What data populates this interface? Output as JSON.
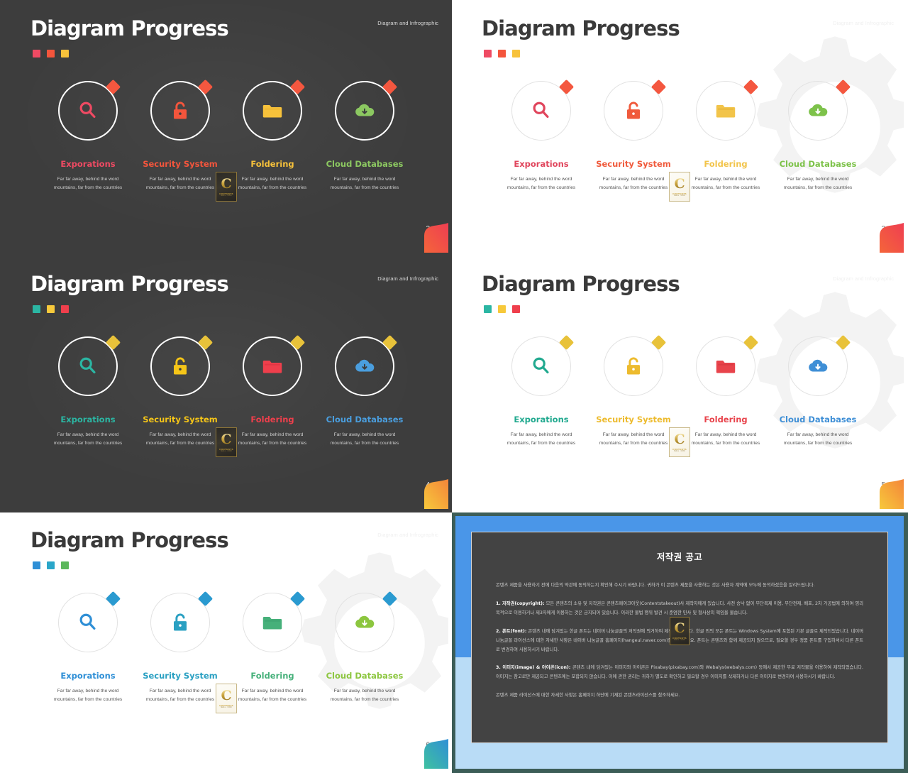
{
  "theme": {
    "page_background": "#3c5d57",
    "dark_slide_bg": "#3d3d3d",
    "light_slide_bg": "#ffffff"
  },
  "common": {
    "title": "Diagram Progress",
    "eyebrow": "Diagram and Infrographic",
    "stamp": {
      "letter": "C",
      "word": "CONTENTS",
      "sub": "MALL . COM"
    },
    "steps_labels": [
      "Exporations",
      "Security System",
      "Foldering",
      "Cloud Databases"
    ],
    "step_description": "Far far away, behind the word mountains, far from the countries",
    "icons": [
      "search-icon",
      "unlock-icon",
      "folder-icon",
      "cloud-download-icon"
    ]
  },
  "slides": [
    {
      "id": "slide-2",
      "theme": "dark",
      "page_number": "2",
      "title": "Diagram Progress",
      "eyebrow": "Diagram and Infrographic",
      "dots": [
        "#ef4a63",
        "#f4553c",
        "#f7c23b"
      ],
      "diamond_color": "#f4573f",
      "corner_from": "#f4653a",
      "corner_to": "#ef3e52",
      "steps": [
        {
          "label": "Exporations",
          "color": "#ef4a63",
          "icon_color": "#ef4a63",
          "icon": "search-icon",
          "desc": "Far far away, behind the word mountains, far from the countries"
        },
        {
          "label": "Security System",
          "color": "#f4553c",
          "icon_color": "#f4553c",
          "icon": "unlock-icon",
          "desc": "Far far away, behind the word mountains, far from the countries"
        },
        {
          "label": "Foldering",
          "color": "#f7c23b",
          "icon_color": "#f7c23b",
          "icon": "folder-icon",
          "desc": "Far far away, behind the word mountains, far from the countries"
        },
        {
          "label": "Cloud Databases",
          "color": "#8cc861",
          "icon_color": "#8cc861",
          "icon": "cloud-download-icon",
          "desc": "Far far away, behind the word mountains, far from the countries"
        }
      ]
    },
    {
      "id": "slide-3",
      "theme": "light",
      "page_number": "3",
      "title": "Diagram Progress",
      "eyebrow": "Diagram and Infrographic",
      "dots": [
        "#ef4a63",
        "#f4553c",
        "#f7c23b"
      ],
      "diamond_color": "#f4573f",
      "corner_from": "#f4653a",
      "corner_to": "#ef3e52",
      "steps": [
        {
          "label": "Exporations",
          "color": "#e0455c",
          "icon_color": "#e0455c",
          "icon": "search-icon",
          "desc": "Far far away, behind the word mountains, far from the countries"
        },
        {
          "label": "Security System",
          "color": "#f05a3c",
          "icon_color": "#f05a3c",
          "icon": "unlock-icon",
          "desc": "Far far away, behind the word mountains, far from the countries"
        },
        {
          "label": "Foldering",
          "color": "#f2c44a",
          "icon_color": "#f2c44a",
          "icon": "folder-icon",
          "desc": "Far far away, behind the word mountains, far from the countries"
        },
        {
          "label": "Cloud Databases",
          "color": "#7dc24a",
          "icon_color": "#7dc24a",
          "icon": "cloud-download-icon",
          "desc": "Far far away, behind the word mountains, far from the countries"
        }
      ]
    },
    {
      "id": "slide-4",
      "theme": "dark",
      "page_number": "4",
      "title": "Diagram Progress",
      "eyebrow": "Diagram and Infrographic",
      "dots": [
        "#2bb6a3",
        "#f7c93b",
        "#ef3f4c"
      ],
      "diamond_color": "#e8c23a",
      "corner_from": "#f7c93b",
      "corner_to": "#f4853a",
      "steps": [
        {
          "label": "Exporations",
          "color": "#2bb6a3",
          "icon_color": "#2bb6a3",
          "icon": "search-icon",
          "desc": "Far far away, behind the word mountains, far from the countries"
        },
        {
          "label": "Security System",
          "color": "#f5c518",
          "icon_color": "#f5c518",
          "icon": "unlock-icon",
          "desc": "Far far away, behind the word mountains, far from the countries"
        },
        {
          "label": "Foldering",
          "color": "#ef3f4c",
          "icon_color": "#ef3f4c",
          "icon": "folder-icon",
          "desc": "Far far away, behind the word mountains, far from the countries"
        },
        {
          "label": "Cloud Databases",
          "color": "#4a9ede",
          "icon_color": "#4a9ede",
          "icon": "cloud-download-icon",
          "desc": "Far far away, behind the word mountains, far from the countries"
        }
      ]
    },
    {
      "id": "slide-5",
      "theme": "light",
      "page_number": "5",
      "title": "Diagram Progress",
      "eyebrow": "Diagram and Infrographic",
      "dots": [
        "#2bb6a3",
        "#f7c93b",
        "#ef3f4c"
      ],
      "diamond_color": "#e8c23a",
      "corner_from": "#f7c93b",
      "corner_to": "#f4853a",
      "steps": [
        {
          "label": "Exporations",
          "color": "#21a98f",
          "icon_color": "#21a98f",
          "icon": "search-icon",
          "desc": "Far far away, behind the word mountains, far from the countries"
        },
        {
          "label": "Security System",
          "color": "#edbb2e",
          "icon_color": "#edbb2e",
          "icon": "unlock-icon",
          "desc": "Far far away, behind the word mountains, far from the countries"
        },
        {
          "label": "Foldering",
          "color": "#e8434b",
          "icon_color": "#e8434b",
          "icon": "folder-icon",
          "desc": "Far far away, behind the word mountains, far from the countries"
        },
        {
          "label": "Cloud Databases",
          "color": "#3f8fd6",
          "icon_color": "#3f8fd6",
          "icon": "cloud-download-icon",
          "desc": "Far far away, behind the word mountains, far from the countries"
        }
      ]
    },
    {
      "id": "slide-6",
      "theme": "light",
      "page_number": "6",
      "title": "Diagram Progress",
      "eyebrow": "Diagram and Infrographic",
      "dots": [
        "#2f8fd6",
        "#2aa6c9",
        "#5cb85c"
      ],
      "diamond_color": "#2a9ad0",
      "corner_from": "#2fa3d8",
      "corner_to": "#3fc1a0",
      "steps": [
        {
          "label": "Exporations",
          "color": "#2f8fd6",
          "icon_color": "#2f8fd6",
          "icon": "search-icon",
          "desc": "Far far away, behind the word mountains, far from the countries"
        },
        {
          "label": "Security System",
          "color": "#2aa0c2",
          "icon_color": "#2aa0c2",
          "icon": "unlock-icon",
          "desc": "Far far away, behind the word mountains, far from the countries"
        },
        {
          "label": "Foldering",
          "color": "#46b07a",
          "icon_color": "#46b07a",
          "icon": "folder-icon",
          "desc": "Far far away, behind the word mountains, far from the countries"
        },
        {
          "label": "Cloud Databases",
          "color": "#8cc63f",
          "icon_color": "#8cc63f",
          "icon": "cloud-download-icon",
          "desc": "Far far away, behind the word mountains, far from the countries"
        }
      ]
    }
  ],
  "copyright_slide": {
    "id": "slide-copyright",
    "frame_color": "#4a96e8",
    "lower_color": "#b9dcf6",
    "card_color": "#434343",
    "title": "저작권 공고",
    "paragraphs": [
      {
        "lead": "",
        "text": "콘텐츠 제품을 사용하기 전에 다음의 약관에 동의하는지 확인해 주시기 바랍니다. 귀하가 이 콘텐츠 제품을 사용하는 것은 사용자 계약에 모두에 동의하셨음을 알려드립니다."
      },
      {
        "lead": "1. 저작권(copyright):",
        "text": " 모든 콘텐츠의 소유 및 저작권은 콘텐츠메이크아웃(Contentstakeout)사 제작자에게 있습니다. 사전 승낙 없이 무단복제 이용, 무단전재, 배포, 2차 가공법에 의하여 영리 목적으로 이용하거나 제3자에게 이용하는 것은 금지되어 있습니다. 이러한 불법 행위 발견 시 준엄한 민사 및 형사상의 책임을 물습니다."
      },
      {
        "lead": "2. 폰트(font):",
        "text": " 콘텐츠 내에 담겨있는 한글 폰트는 네이버 나눔글꼴의 저작권에 의거하여 제작되었습니다. 한글 외의 모든 폰트는 Windows System에 포함된 기본 글꼴로 제작되었습니다. 네이버 나눔글꼴 라이선스에 대한 자세한 사항은 네이버 나눔글꼴 홈페이지(hangeul.naver.com)를 참조하세요. 폰트는 콘텐츠와 함께 제공되지 않으므로, 필요할 경우 정품 폰트를 구입하셔서 다른 폰트로 변경하여 사용하시기 바랍니다."
      },
      {
        "lead": "3. 이미지(image) & 아이콘(icon):",
        "text": " 콘텐츠 내에 담겨있는 이미지와 아이콘은 Pixabay(pixabay.com)와 Webalys(webalys.com) 등에서 제공한 무료 저작물을 이용하여 제작되었습니다. 이미지는 참고로만 제공되고 콘텐츠에는 포함되지 않습니다. 이에 관한 권리는 귀하가 별도로 확인하고 필요할 경우 이미지를 삭제하거나 다른 이미지로 변경하여 사용하시기 바랍니다."
      },
      {
        "lead": "",
        "text": "콘텐츠 제품 라이선스에 대한 자세한 사항은 홈페이지 하단에 기재된 콘텐츠라이선스를 참조하세요."
      }
    ]
  }
}
